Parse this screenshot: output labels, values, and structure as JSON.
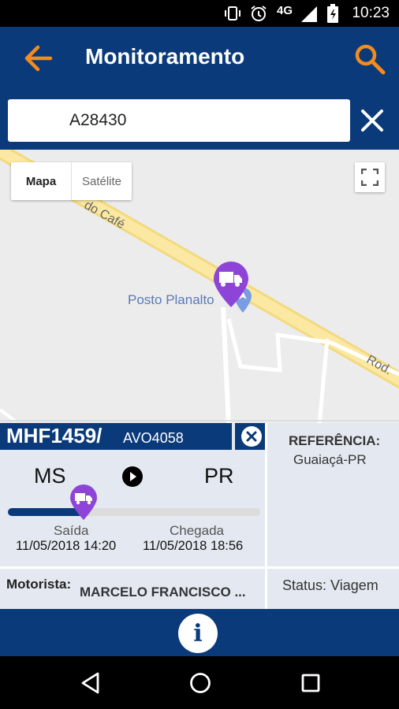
{
  "status_bar": {
    "network": "4G",
    "time": "10:23",
    "icons": [
      "vibrate-icon",
      "alarm-icon",
      "signal-icon",
      "battery-icon"
    ]
  },
  "app_bar": {
    "title": "Monitoramento",
    "back_icon": "arrow-left-icon",
    "search_icon": "search-icon",
    "accent_color": "#f28c1e",
    "bar_color": "#0a3a7a"
  },
  "search": {
    "value": "A28430",
    "clear_icon": "close-icon"
  },
  "map": {
    "type_buttons": [
      "Mapa",
      "Satélite"
    ],
    "selected_type": "Mapa",
    "road_label_1": "do Café",
    "road_label_2": "Rod.",
    "poi_label": "Posto Planalto",
    "marker_icon": "truck-pin-icon",
    "marker_color": "#8e44d6"
  },
  "vehicle": {
    "plate": "MHF1459/",
    "trailer": "AVO4058",
    "origin_uf": "MS",
    "destination_uf": "PR",
    "progress": 0.3,
    "departure_label": "Saída",
    "departure_time": "11/05/2018 14:20",
    "arrival_label": "Chegada",
    "arrival_time": "11/05/2018 18:56",
    "reference_title": "REFERÊNCIA:",
    "reference_value": "Guaiaçá-PR",
    "driver_label": "Motorista:",
    "driver_name": "MARCELO FRANCISCO ...",
    "status_text": "Status: Viagem"
  },
  "bottom": {
    "info_glyph": "i"
  }
}
